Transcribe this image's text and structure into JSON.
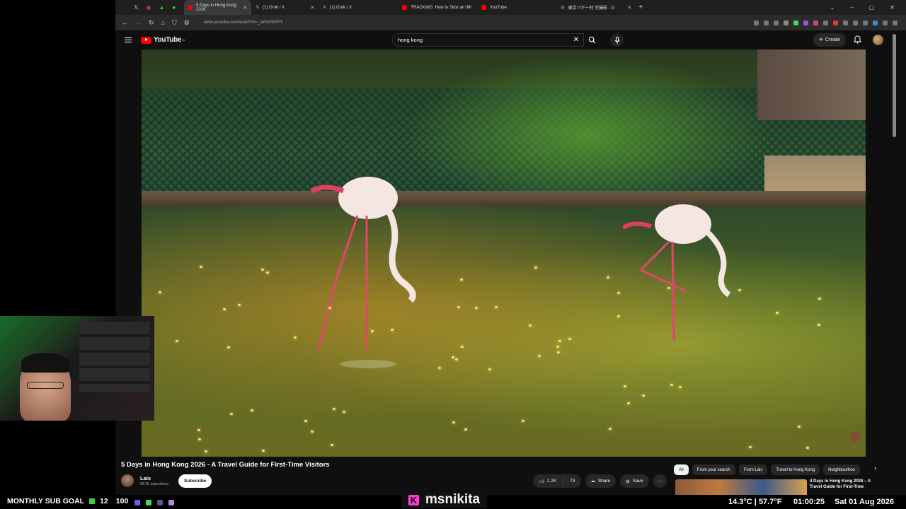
{
  "browser": {
    "tabs": [
      {
        "label": "5 Days in Hong Kong 2026",
        "color": "#ff0000",
        "active": true
      },
      {
        "label": "(1) Grok / X",
        "color": "#ffffff",
        "active": false
      },
      {
        "label": "(1) Grok / X",
        "color": "#ffffff",
        "active": false
      },
      {
        "label": "TRACKING: How to Stick an IM/",
        "color": "#ff0000",
        "active": false
      },
      {
        "label": "YouTube",
        "color": "#ff0000",
        "active": false
      },
      {
        "label": "東京バギー村 完撮影 - G",
        "color": "#dddddd",
        "active": false
      }
    ],
    "url": "www.youtube.com/watch?v=_se5nVhPPY"
  },
  "youtube": {
    "logo_text": "YouTube",
    "logo_region": "NL",
    "search": {
      "value": "hong kong"
    },
    "create_label": "Create"
  },
  "video": {
    "title": "5 Days in Hong Kong 2026 - A Travel Guide for First-Time Visitors",
    "channel": "Lais",
    "subscribers": "58.2K subscribers",
    "subscribe_label": "Subscribe",
    "likes": "1.2K",
    "dislikes": "73",
    "share_label": "Share",
    "save_label": "Save"
  },
  "chips": [
    "All",
    "From your search",
    "From Lais",
    "Travel to Hong Kong",
    "Neighbourhoo"
  ],
  "recommendation": {
    "title": "4 Days in Hong Kong 2026 – A Travel Guide for First-Time"
  },
  "stream": {
    "sub_goal_label": "MONTHLY SUB GOAL",
    "sub_goal_current": "12",
    "sub_goal_target": "100",
    "kick_name": "msnikita",
    "weather": "14.3°C | 57.7°F",
    "timer": "01:00:25",
    "date": "Sat 01 Aug 2026"
  },
  "colors": {
    "yt_red": "#ff0000",
    "kick_pink": "#ff3cd5",
    "goal_green": "#36d03e"
  }
}
